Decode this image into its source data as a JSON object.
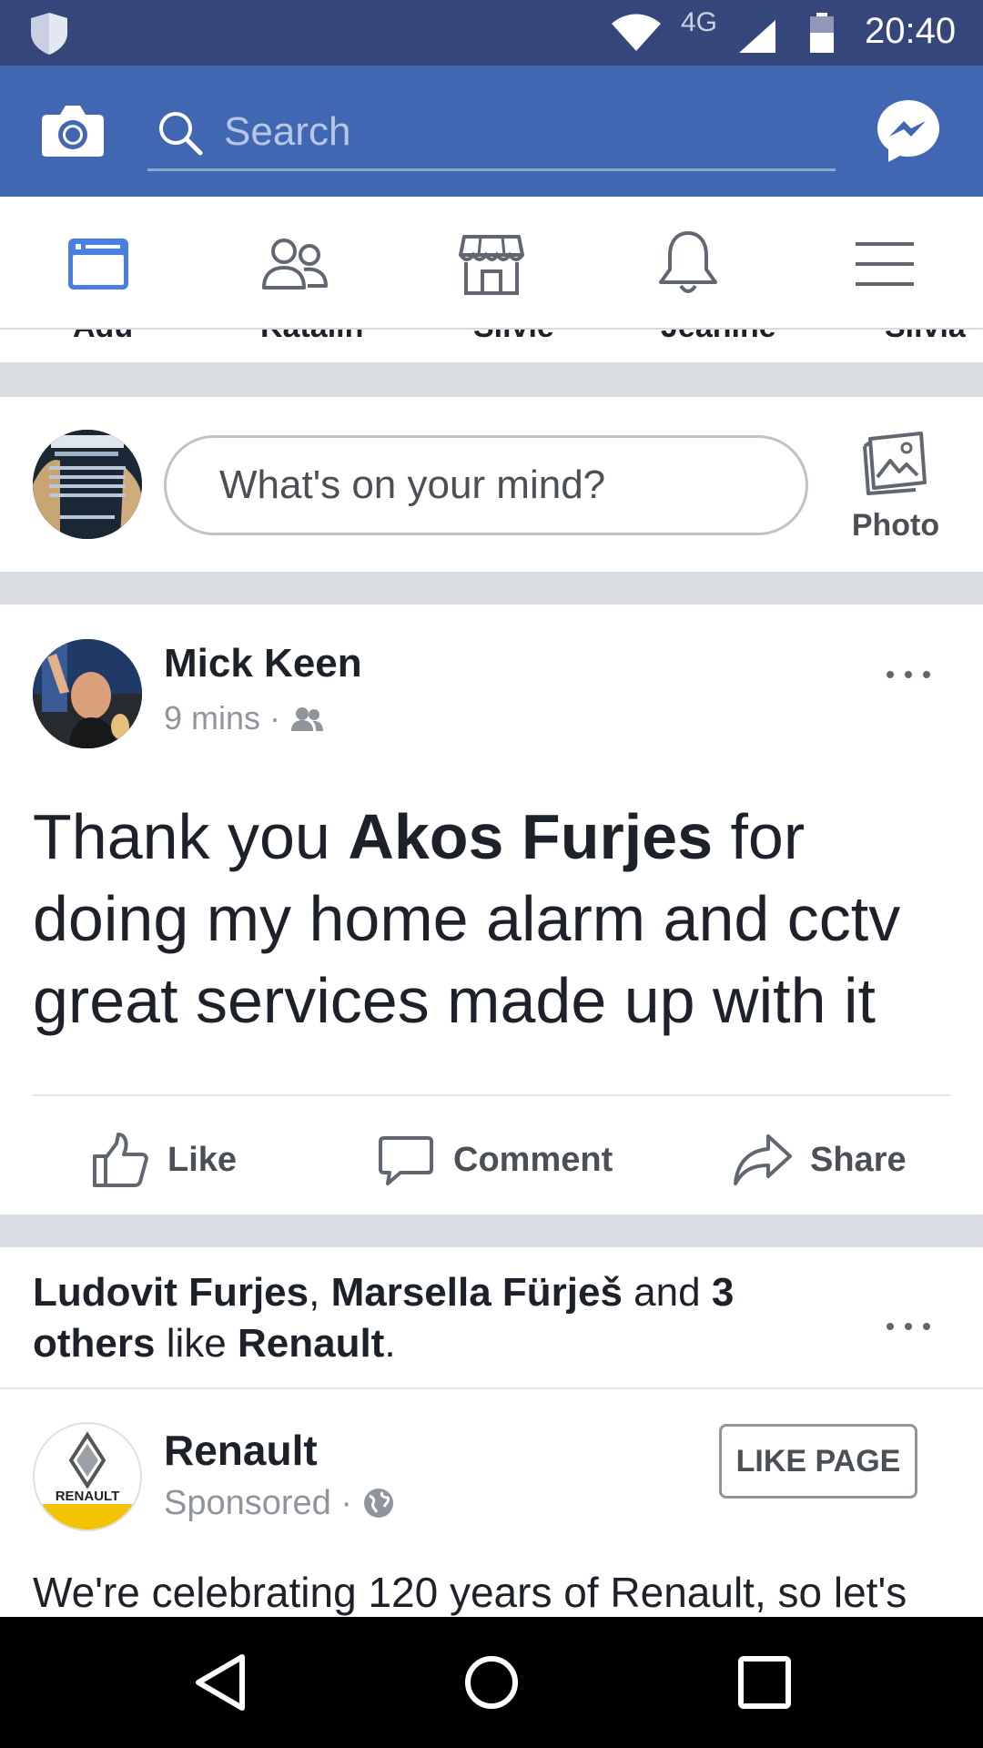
{
  "status_bar": {
    "network": "4G",
    "time": "20:40"
  },
  "header": {
    "search_placeholder": "Search"
  },
  "tabs": [
    {
      "name": "feed",
      "active": true
    },
    {
      "name": "friends",
      "active": false
    },
    {
      "name": "marketplace",
      "active": false
    },
    {
      "name": "notifications",
      "active": false
    },
    {
      "name": "menu",
      "active": false
    }
  ],
  "stories_clipped": [
    "Adu",
    "Katalin",
    "Silvie",
    "Jeanine",
    "Silvia"
  ],
  "composer": {
    "prompt": "What's on your mind?",
    "photo_label": "Photo"
  },
  "post": {
    "author": "Mick Keen",
    "time": "9 mins",
    "separator": "·",
    "text_before": "Thank you ",
    "mention": "Akos Furjes",
    "text_after": " for doing my home alarm and cctv great services made up with it",
    "actions": {
      "like": "Like",
      "comment": "Comment",
      "share": "Share"
    }
  },
  "suggested": {
    "friend1": "Ludovit Furjes",
    "comma": ", ",
    "friend2": "Marsella Fürješ",
    "and": " and ",
    "others_count": "3",
    "others_word": "others",
    "likes": " like ",
    "page": "Renault",
    "period": "."
  },
  "sponsored": {
    "brand": "Renault",
    "logo_text": "RENAULT",
    "label": "Sponsored",
    "separator": "·",
    "like_page": "LIKE PAGE",
    "body": "We're celebrating 120 years of Renault, so let's"
  },
  "colors": {
    "status_bar": "#35467a",
    "brand_blue": "#4267b2",
    "active_tab": "#4a7fe0",
    "divider_gray": "#dadde1"
  }
}
